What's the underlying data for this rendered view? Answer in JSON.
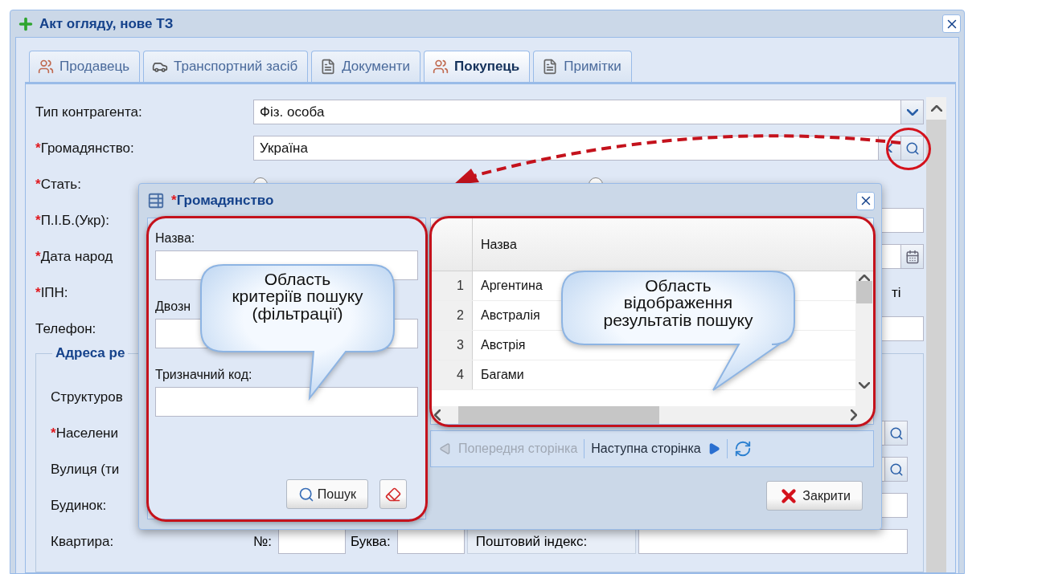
{
  "window": {
    "title": "Акт огляду, нове ТЗ"
  },
  "tabs": [
    {
      "label": "Продавець",
      "selected": false
    },
    {
      "label": "Транспортний засіб",
      "selected": false
    },
    {
      "label": "Документи",
      "selected": false
    },
    {
      "label": "Покупець",
      "selected": true
    },
    {
      "label": "Примітки",
      "selected": false
    }
  ],
  "form": {
    "rows": [
      {
        "kind": "select",
        "label": "Тип контрагента:",
        "value": "Фіз. особа"
      },
      {
        "kind": "lookup",
        "asterisk": "*",
        "label": "Громадянство:",
        "value": "Україна"
      },
      {
        "kind": "radio",
        "asterisk": "*",
        "label": "Стать:",
        "options": [
          {
            "selected": false
          },
          {
            "selected": false
          }
        ]
      },
      {
        "kind": "text",
        "asterisk": "*",
        "label": "П.І.Б.(Укр):"
      },
      {
        "kind": "date",
        "asterisk": "*",
        "label": "Дата народ"
      },
      {
        "kind": "note",
        "asterisk": "*",
        "label": "ІПН:",
        "note": "ті"
      },
      {
        "kind": "text",
        "label": "Телефон:"
      }
    ],
    "address": {
      "legend": "Адреса ре",
      "rows": [
        {
          "kind": "label",
          "label": "Структуров"
        },
        {
          "kind": "search",
          "asterisk": "*",
          "label": "Населени"
        },
        {
          "kind": "search",
          "label": "Вулиця (ти"
        },
        {
          "kind": "text",
          "label": "Будинок:"
        },
        {
          "kind": "apartment",
          "label": "Квартира:",
          "number_label": "№:",
          "letter_label": "Буква:",
          "postcode_label": "Поштовий індекс:"
        }
      ]
    }
  },
  "dialog": {
    "asterisk": "*",
    "title": "Громадянство",
    "filter": {
      "fields": [
        {
          "label": "Назва:"
        },
        {
          "label": "Двозн"
        },
        {
          "label": "Тризначний код:"
        }
      ],
      "search_button": "Пошук"
    },
    "grid": {
      "columns": [
        "Назва"
      ],
      "rows": [
        {
          "number": "1",
          "name": "Аргентина"
        },
        {
          "number": "2",
          "name": "Австралія"
        },
        {
          "number": "3",
          "name": "Австрія"
        },
        {
          "number": "4",
          "name": "Багами"
        }
      ]
    },
    "pager": {
      "previous": {
        "label": "Попередня сторінка",
        "disabled": true
      },
      "next": {
        "label": "Наступна сторінка",
        "disabled": false
      }
    },
    "close_button": "Закрити"
  },
  "callouts": [
    {
      "text": "Область\nкритеріїв пошуку\n(фільтрації)"
    },
    {
      "text": "Область\nвідображення\nрезультатів пошуку"
    }
  ]
}
